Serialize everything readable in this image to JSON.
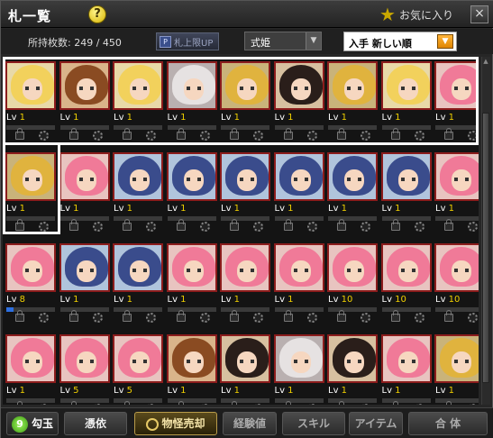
{
  "window": {
    "title": "札一覧",
    "help": "?",
    "favorites_label": "お気に入り",
    "close": "×"
  },
  "toolbar": {
    "count_label": "所持枚数: 249 / 450",
    "limit_button": "札上限UP",
    "limit_icon": "P",
    "filter_value": "式姫",
    "sort_value": "入手 新しい順"
  },
  "lv_prefix": "Lv",
  "cards": [
    [
      {
        "lv": "1",
        "theme": "blonde",
        "xp": 0
      },
      {
        "lv": "1",
        "theme": "brown",
        "xp": 0
      },
      {
        "lv": "1",
        "theme": "blonde",
        "xp": 0
      },
      {
        "lv": "1",
        "theme": "silver",
        "xp": 0
      },
      {
        "lv": "1",
        "theme": "golden",
        "xp": 0
      },
      {
        "lv": "1",
        "theme": "dark",
        "xp": 0
      },
      {
        "lv": "1",
        "theme": "golden",
        "xp": 0
      },
      {
        "lv": "1",
        "theme": "blonde",
        "xp": 0
      },
      {
        "lv": "1",
        "theme": "pink",
        "xp": 0
      }
    ],
    [
      {
        "lv": "1",
        "theme": "golden",
        "xp": 0
      },
      {
        "lv": "1",
        "theme": "pink",
        "xp": 0
      },
      {
        "lv": "1",
        "theme": "navy",
        "xp": 0
      },
      {
        "lv": "1",
        "theme": "navy",
        "xp": 0
      },
      {
        "lv": "1",
        "theme": "navy",
        "xp": 0
      },
      {
        "lv": "1",
        "theme": "navy",
        "xp": 0
      },
      {
        "lv": "1",
        "theme": "navy",
        "xp": 0
      },
      {
        "lv": "1",
        "theme": "navy",
        "xp": 0
      },
      {
        "lv": "1",
        "theme": "pink",
        "xp": 0
      }
    ],
    [
      {
        "lv": "8",
        "theme": "pink",
        "xp": 0.15
      },
      {
        "lv": "1",
        "theme": "navy",
        "xp": 0
      },
      {
        "lv": "1",
        "theme": "navy",
        "xp": 0
      },
      {
        "lv": "1",
        "theme": "pink",
        "xp": 0
      },
      {
        "lv": "1",
        "theme": "pink",
        "xp": 0
      },
      {
        "lv": "1",
        "theme": "pink",
        "xp": 0
      },
      {
        "lv": "10",
        "theme": "pink",
        "xp": 0
      },
      {
        "lv": "10",
        "theme": "pink",
        "xp": 0
      },
      {
        "lv": "10",
        "theme": "pink",
        "xp": 0
      }
    ],
    [
      {
        "lv": "1",
        "theme": "pink",
        "xp": 0
      },
      {
        "lv": "5",
        "theme": "pink",
        "xp": 0
      },
      {
        "lv": "5",
        "theme": "pink",
        "xp": 0
      },
      {
        "lv": "1",
        "theme": "brown",
        "xp": 0
      },
      {
        "lv": "1",
        "theme": "dark",
        "xp": 0
      },
      {
        "lv": "1",
        "theme": "silver",
        "xp": 0
      },
      {
        "lv": "1",
        "theme": "dark",
        "xp": 0
      },
      {
        "lv": "1",
        "theme": "pink",
        "xp": 0
      },
      {
        "lv": "1",
        "theme": "golden",
        "xp": 0
      }
    ]
  ],
  "themes": {
    "blonde": {
      "bg": "#e8d9a8",
      "hair": "#f2d15c"
    },
    "brown": {
      "bg": "#d9b48a",
      "hair": "#8a4b22"
    },
    "silver": {
      "bg": "#b9b0b0",
      "hair": "#e6e2e2"
    },
    "golden": {
      "bg": "#c9b37a",
      "hair": "#e0b33e"
    },
    "dark": {
      "bg": "#d7c0a0",
      "hair": "#2a1e1a"
    },
    "pink": {
      "bg": "#e8c4c0",
      "hair": "#f07a98"
    },
    "navy": {
      "bg": "#b0c4dc",
      "hair": "#3a4c8c"
    }
  },
  "bottom": {
    "magatama_count": "9",
    "magatama": "勾玉",
    "hyoui": "憑依",
    "sell": "物怪売却",
    "exp": "経験値",
    "skill": "スキル",
    "item": "アイテム",
    "fuse": "合 体"
  },
  "colors": {
    "accent": "#f0d000",
    "frame": "#8b1c1c",
    "xp": "#2d6fe0"
  }
}
